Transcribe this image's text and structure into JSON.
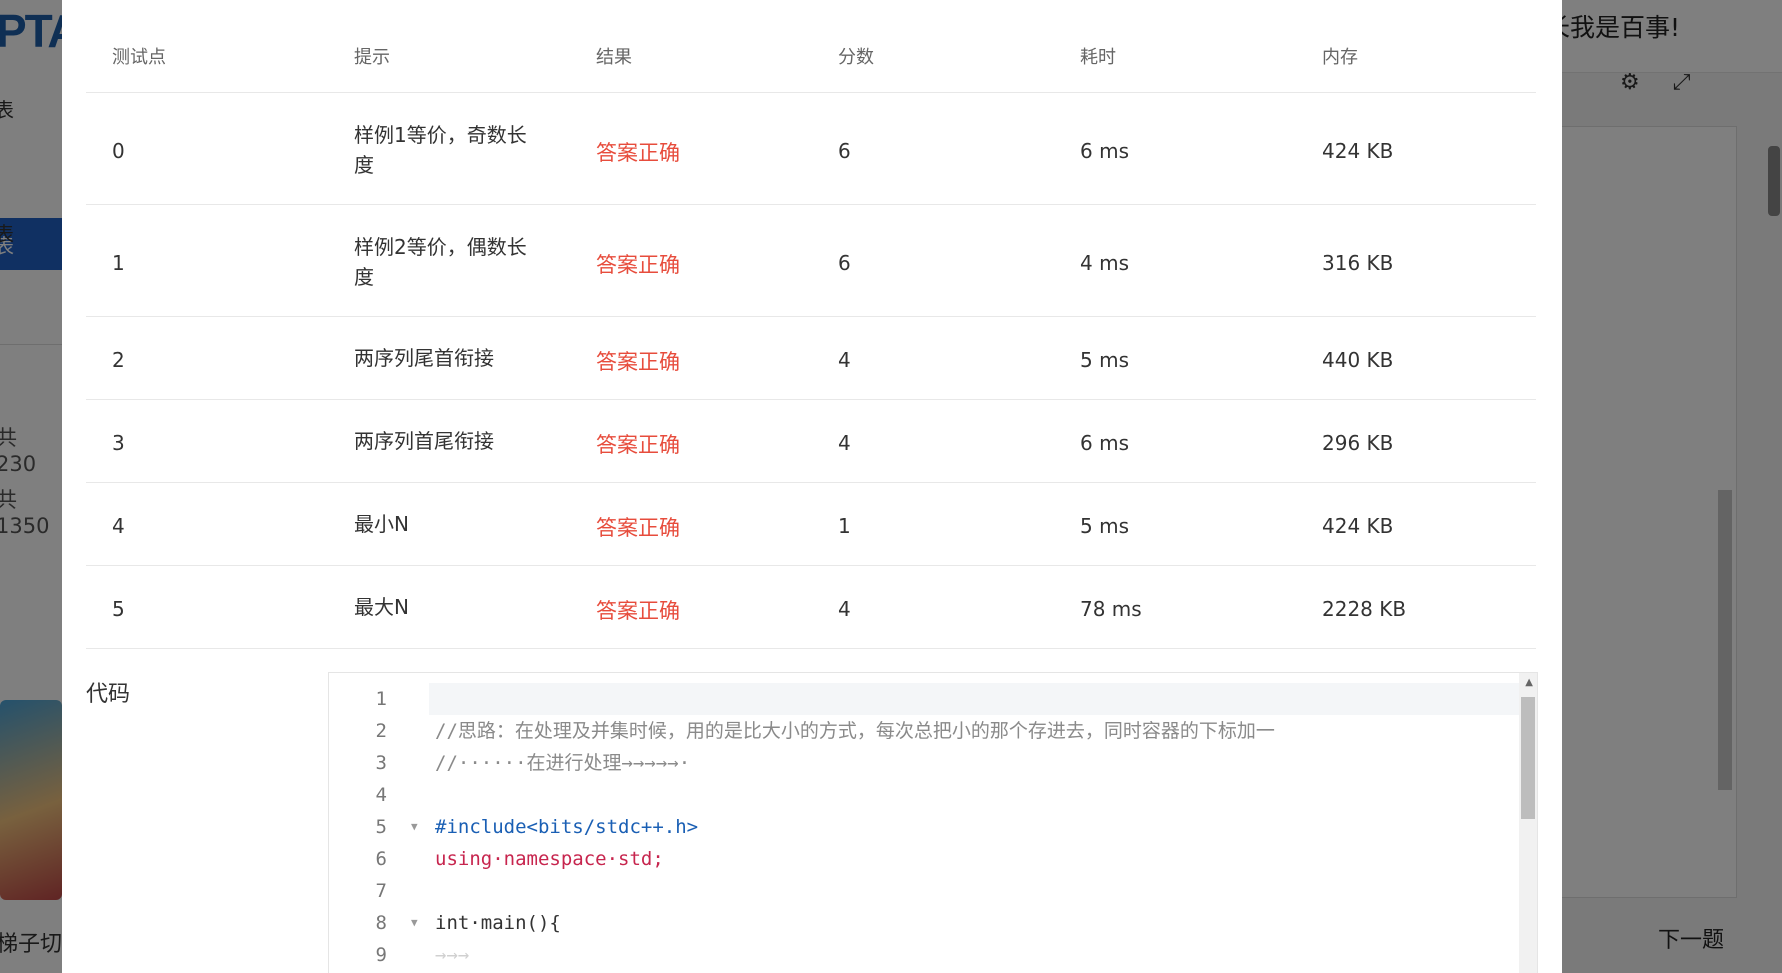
{
  "background": {
    "logo": "PTA",
    "user_greeting": "长我是百事!",
    "sidebar": {
      "items": [
        "表",
        "表",
        "表"
      ],
      "stats": [
        "共 230",
        "共 1350"
      ],
      "bottom_text": "梯子切"
    },
    "next_button": "下一题"
  },
  "results_table": {
    "headers": [
      "测试点",
      "提示",
      "结果",
      "分数",
      "耗时",
      "内存"
    ],
    "rows": [
      {
        "id": "0",
        "hint": "样例1等价，奇数长度",
        "result": "答案正确",
        "score": "6",
        "time": "6 ms",
        "memory": "424 KB"
      },
      {
        "id": "1",
        "hint": "样例2等价，偶数长度",
        "result": "答案正确",
        "score": "6",
        "time": "4 ms",
        "memory": "316 KB"
      },
      {
        "id": "2",
        "hint": "两序列尾首衔接",
        "result": "答案正确",
        "score": "4",
        "time": "5 ms",
        "memory": "440 KB"
      },
      {
        "id": "3",
        "hint": "两序列首尾衔接",
        "result": "答案正确",
        "score": "4",
        "time": "6 ms",
        "memory": "296 KB"
      },
      {
        "id": "4",
        "hint": "最小N",
        "result": "答案正确",
        "score": "1",
        "time": "5 ms",
        "memory": "424 KB"
      },
      {
        "id": "5",
        "hint": "最大N",
        "result": "答案正确",
        "score": "4",
        "time": "78 ms",
        "memory": "2228 KB"
      }
    ]
  },
  "code": {
    "label": "代码",
    "lines": [
      {
        "n": "1",
        "text": ""
      },
      {
        "n": "2",
        "text": "//思路：在处理及并集时候，用的是比大小的方式，每次总把小的那个存进去，同时容器的下标加一"
      },
      {
        "n": "3",
        "text": "//······在进行处理→→→→→·"
      },
      {
        "n": "4",
        "text": ""
      },
      {
        "n": "5",
        "text": "#include<bits/stdc++.h>"
      },
      {
        "n": "6",
        "text": "using·namespace·std;"
      },
      {
        "n": "7",
        "text": ""
      },
      {
        "n": "8",
        "text": "int·main(){"
      },
      {
        "n": "9",
        "text": "→→→"
      }
    ]
  },
  "colors": {
    "accepted": "#e74c3c",
    "brand": "#2060c4"
  }
}
